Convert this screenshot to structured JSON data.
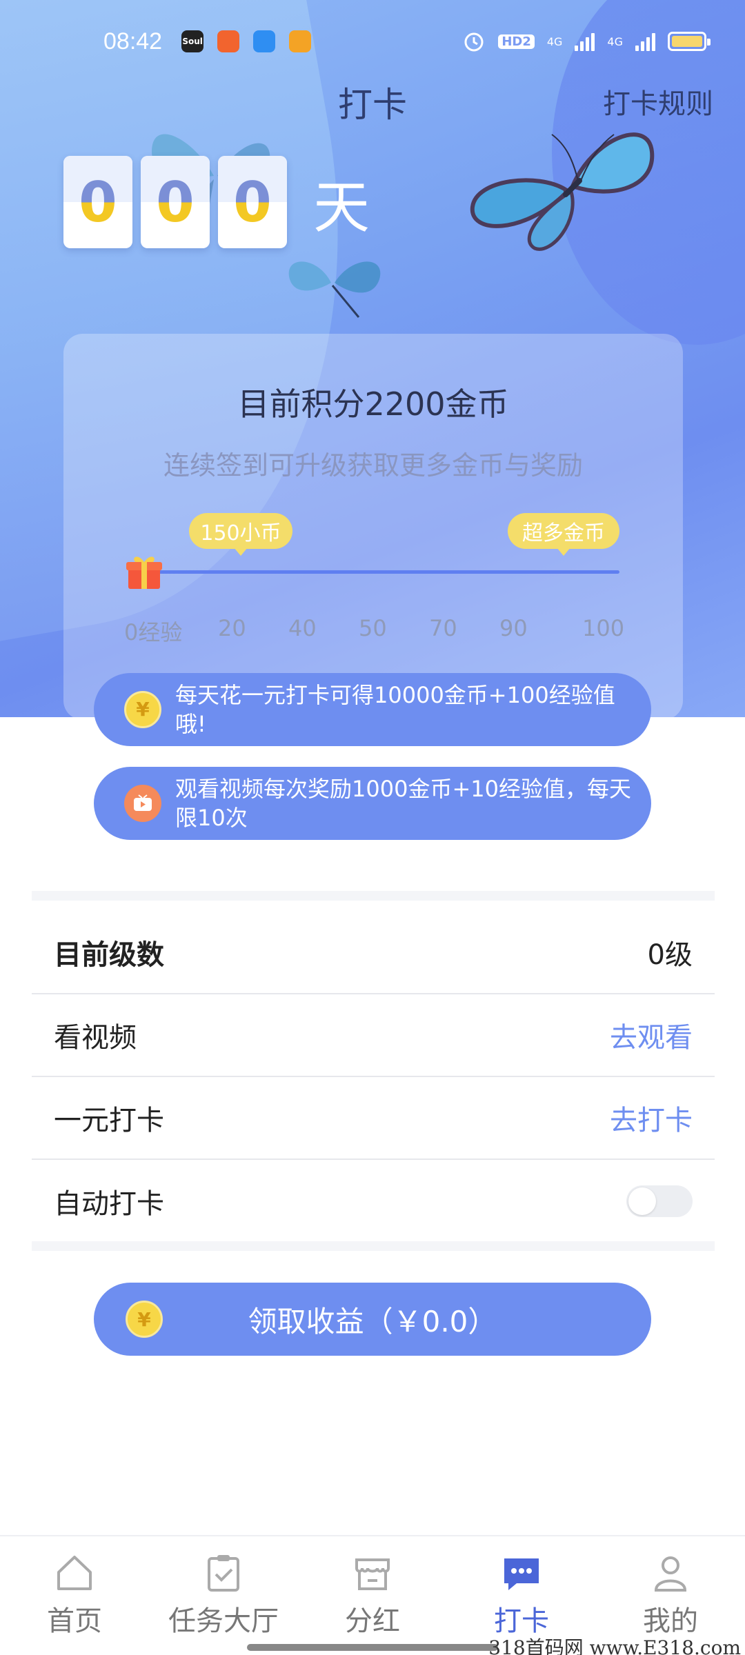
{
  "status_bar": {
    "time": "08:42",
    "apps": [
      "Soul",
      "app-orange",
      "app-blue",
      "weibo"
    ],
    "hd_label": "HD2",
    "network_1": "4G",
    "network_2": "4G"
  },
  "header": {
    "title": "打卡",
    "rules_link": "打卡规则"
  },
  "counter": {
    "digits": [
      "0",
      "0",
      "0"
    ],
    "unit": "天"
  },
  "points_card": {
    "title": "目前积分2200金币",
    "subtitle": "连续签到可升级获取更多金币与奖励",
    "bubble_left": "150小币",
    "bubble_right": "超多金币",
    "ticks": [
      "0经验",
      "20",
      "40",
      "50",
      "70",
      "90",
      "100"
    ],
    "progress": 0
  },
  "rewards": [
    {
      "icon": "coin-icon",
      "text": "每天花一元打卡可得10000金币+100经验值哦!"
    },
    {
      "icon": "video-icon",
      "text": "观看视频每次奖励1000金币+10经验值，每天限10次"
    }
  ],
  "settings": {
    "level_label": "目前级数",
    "level_value": "0级",
    "video_label": "看视频",
    "video_action": "去观看",
    "checkin_label": "一元打卡",
    "checkin_action": "去打卡",
    "auto_label": "自动打卡",
    "auto_enabled": false
  },
  "claim_button": {
    "label": "领取收益（￥0.0）"
  },
  "bottom_nav": [
    {
      "label": "首页",
      "icon": "home-icon",
      "active": false
    },
    {
      "label": "任务大厅",
      "icon": "clipboard-check-icon",
      "active": false
    },
    {
      "label": "分红",
      "icon": "store-icon",
      "active": false
    },
    {
      "label": "打卡",
      "icon": "chat-bubble-icon",
      "active": true
    },
    {
      "label": "我的",
      "icon": "user-icon",
      "active": false
    }
  ],
  "watermark": "318首码网 www.E318.com",
  "colors": {
    "accent": "#6e8ef0",
    "coin": "#f7d747",
    "active_nav": "#4b66d8"
  }
}
